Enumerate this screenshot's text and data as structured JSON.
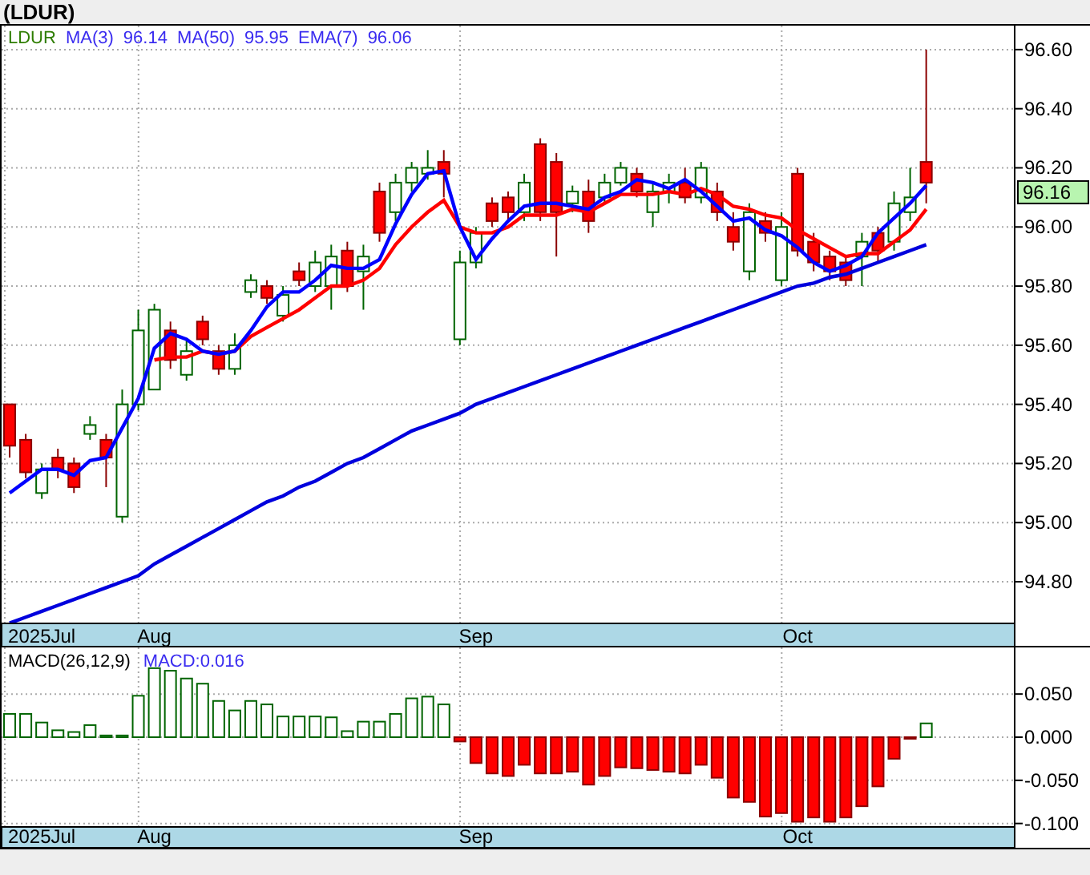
{
  "title": "(LDUR)",
  "price_chart": {
    "symbol": "LDUR",
    "indicators": [
      {
        "label": "MA(3)",
        "value": "96.14"
      },
      {
        "label": "MA(50)",
        "value": "95.95"
      },
      {
        "label": "EMA(7)",
        "value": "96.06"
      }
    ],
    "last_price": "96.16",
    "chart_data": {
      "type": "candlestick",
      "grid": true,
      "categories": [
        null,
        null,
        "2025Jul",
        null,
        null,
        null,
        null,
        null,
        null,
        "Aug",
        null,
        null,
        null,
        null,
        null,
        null,
        null,
        null,
        null,
        null,
        null,
        null,
        null,
        null,
        null,
        null,
        null,
        null,
        null,
        "Sep",
        null,
        null,
        null,
        null,
        null,
        null,
        null,
        null,
        null,
        null,
        null,
        null,
        null,
        null,
        null,
        null,
        null,
        null,
        null,
        "Oct",
        null,
        null,
        null,
        null,
        null,
        null,
        null,
        null,
        null,
        null,
        null,
        null,
        null
      ],
      "ylim": [
        94.659,
        96.681
      ],
      "yticks": [
        {
          "value": 96.6,
          "label": "96.60"
        },
        {
          "value": 96.4,
          "label": "96.40"
        },
        {
          "value": 96.2,
          "label": "96.20"
        },
        {
          "value": 96.0,
          "label": "96.00"
        },
        {
          "value": 95.8,
          "label": "95.80"
        },
        {
          "value": 95.6,
          "label": "95.60"
        },
        {
          "value": 95.4,
          "label": "95.40"
        },
        {
          "value": 95.2,
          "label": "95.20"
        },
        {
          "value": 95.0,
          "label": "95.00"
        },
        {
          "value": 94.8,
          "label": "94.80"
        }
      ],
      "ohlc": [
        [
          95.4,
          95.4,
          95.22,
          95.26
        ],
        [
          95.28,
          95.3,
          95.15,
          95.17
        ],
        [
          95.1,
          95.2,
          95.08,
          95.18
        ],
        [
          95.22,
          95.25,
          95.15,
          95.18
        ],
        [
          95.2,
          95.22,
          95.1,
          95.12
        ],
        [
          95.3,
          95.36,
          95.28,
          95.33
        ],
        [
          95.28,
          95.3,
          95.12,
          95.22
        ],
        [
          95.02,
          95.45,
          95.0,
          95.4
        ],
        [
          95.4,
          95.72,
          95.38,
          95.65
        ],
        [
          95.45,
          95.74,
          95.45,
          95.72
        ],
        [
          95.65,
          95.68,
          95.52,
          95.55
        ],
        [
          95.5,
          95.62,
          95.48,
          95.58
        ],
        [
          95.68,
          95.7,
          95.6,
          95.62
        ],
        [
          95.58,
          95.6,
          95.5,
          95.52
        ],
        [
          95.52,
          95.64,
          95.5,
          95.6
        ],
        [
          95.78,
          95.84,
          95.76,
          95.82
        ],
        [
          95.8,
          95.82,
          95.74,
          95.76
        ],
        [
          95.7,
          95.8,
          95.68,
          95.77
        ],
        [
          95.85,
          95.88,
          95.8,
          95.82
        ],
        [
          95.8,
          95.92,
          95.78,
          95.88
        ],
        [
          95.8,
          95.94,
          95.72,
          95.9
        ],
        [
          95.92,
          95.95,
          95.78,
          95.8
        ],
        [
          95.85,
          95.94,
          95.72,
          95.9
        ],
        [
          96.12,
          96.15,
          95.95,
          95.98
        ],
        [
          96.05,
          96.18,
          96.02,
          96.15
        ],
        [
          96.15,
          96.22,
          96.12,
          96.2
        ],
        [
          96.18,
          96.26,
          96.16,
          96.2
        ],
        [
          96.22,
          96.26,
          96.1,
          96.18
        ],
        [
          95.62,
          95.92,
          95.6,
          95.88
        ],
        [
          95.88,
          96.0,
          95.86,
          95.98
        ],
        [
          96.08,
          96.1,
          96.0,
          96.02
        ],
        [
          96.1,
          96.12,
          96.02,
          96.05
        ],
        [
          96.05,
          96.18,
          96.02,
          96.15
        ],
        [
          96.28,
          96.3,
          96.02,
          96.05
        ],
        [
          96.22,
          96.25,
          95.9,
          96.05
        ],
        [
          96.08,
          96.14,
          96.05,
          96.12
        ],
        [
          96.12,
          96.16,
          95.98,
          96.02
        ],
        [
          96.1,
          96.18,
          96.08,
          96.15
        ],
        [
          96.15,
          96.22,
          96.14,
          96.2
        ],
        [
          96.18,
          96.2,
          96.1,
          96.12
        ],
        [
          96.05,
          96.15,
          96.0,
          96.12
        ],
        [
          96.12,
          96.18,
          96.08,
          96.15
        ],
        [
          96.15,
          96.2,
          96.08,
          96.1
        ],
        [
          96.1,
          96.22,
          96.08,
          96.2
        ],
        [
          96.12,
          96.15,
          96.02,
          96.05
        ],
        [
          96.0,
          96.05,
          95.92,
          95.95
        ],
        [
          95.85,
          96.08,
          95.82,
          96.05
        ],
        [
          96.02,
          96.05,
          95.95,
          95.98
        ],
        [
          95.82,
          96.05,
          95.8,
          96.0
        ],
        [
          96.18,
          96.2,
          95.9,
          95.92
        ],
        [
          95.95,
          95.98,
          95.85,
          95.88
        ],
        [
          95.9,
          95.92,
          95.82,
          95.85
        ],
        [
          95.88,
          95.9,
          95.8,
          95.82
        ],
        [
          95.9,
          95.98,
          95.8,
          95.95
        ],
        [
          95.98,
          96.0,
          95.88,
          95.92
        ],
        [
          95.95,
          96.12,
          95.92,
          96.08
        ],
        [
          96.05,
          96.2,
          96.02,
          96.1
        ],
        [
          96.22,
          96.6,
          96.08,
          96.15
        ],
        null,
        null,
        null,
        null,
        null
      ],
      "series": [
        {
          "type": "line",
          "color": "#0000dd",
          "values": [
            94.66,
            94.68,
            94.7,
            94.72,
            94.74,
            94.76,
            94.78,
            94.8,
            94.82,
            94.86,
            94.89,
            94.92,
            94.95,
            94.98,
            95.01,
            95.04,
            95.07,
            95.09,
            95.12,
            95.14,
            95.17,
            95.2,
            95.22,
            95.25,
            95.28,
            95.31,
            95.33,
            95.35,
            95.37,
            95.4,
            95.42,
            95.44,
            95.46,
            95.48,
            95.5,
            95.52,
            95.54,
            95.56,
            95.58,
            95.6,
            95.62,
            95.64,
            95.66,
            95.68,
            95.7,
            95.72,
            95.74,
            95.76,
            95.78,
            95.8,
            95.81,
            95.83,
            95.84,
            95.86,
            95.88,
            95.9,
            95.92,
            95.94,
            null,
            null,
            null,
            null,
            null
          ]
        },
        {
          "type": "line",
          "color": "#ff0000",
          "values": [
            null,
            null,
            null,
            null,
            null,
            null,
            null,
            null,
            null,
            95.55,
            95.56,
            95.56,
            95.58,
            95.57,
            95.58,
            95.63,
            95.66,
            95.69,
            95.72,
            95.76,
            95.8,
            95.8,
            95.82,
            95.86,
            95.94,
            96.0,
            96.05,
            96.09,
            96.0,
            95.98,
            95.98,
            96.0,
            96.04,
            96.04,
            96.04,
            96.06,
            96.05,
            96.08,
            96.11,
            96.11,
            96.11,
            96.12,
            96.11,
            96.13,
            96.11,
            96.07,
            96.06,
            96.04,
            96.03,
            95.99,
            95.96,
            95.93,
            95.9,
            95.91,
            95.91,
            95.95,
            95.99,
            96.06,
            null,
            null,
            null,
            null,
            null
          ]
        },
        {
          "type": "line",
          "color": "#0000ff",
          "values": [
            95.1,
            95.14,
            95.18,
            95.18,
            95.16,
            95.21,
            95.22,
            95.32,
            95.42,
            95.59,
            95.64,
            95.62,
            95.58,
            95.57,
            95.58,
            95.65,
            95.73,
            95.78,
            95.78,
            95.82,
            95.87,
            95.86,
            95.86,
            95.89,
            96.01,
            96.11,
            96.18,
            96.19,
            96.0,
            95.89,
            95.96,
            96.02,
            96.07,
            96.08,
            96.08,
            96.07,
            96.06,
            96.1,
            96.12,
            96.16,
            96.15,
            96.13,
            96.16,
            96.12,
            96.07,
            96.02,
            96.03,
            95.99,
            95.97,
            95.93,
            95.88,
            95.85,
            95.87,
            95.9,
            95.98,
            96.03,
            96.08,
            96.14,
            null,
            null,
            null,
            null,
            null
          ]
        }
      ]
    }
  },
  "macd_chart": {
    "label": "MACD(26,12,9)",
    "reading": "MACD:0.016",
    "chart_data": {
      "type": "bar",
      "grid": true,
      "categories": [
        null,
        null,
        "2025Jul",
        null,
        null,
        null,
        null,
        null,
        null,
        "Aug",
        null,
        null,
        null,
        null,
        null,
        null,
        null,
        null,
        null,
        null,
        null,
        null,
        null,
        null,
        null,
        null,
        null,
        null,
        null,
        "Sep",
        null,
        null,
        null,
        null,
        null,
        null,
        null,
        null,
        null,
        null,
        null,
        null,
        null,
        null,
        null,
        null,
        null,
        null,
        null,
        "Oct",
        null,
        null,
        null,
        null,
        null,
        null,
        null,
        null,
        null,
        null,
        null,
        null,
        null
      ],
      "ylim": [
        -0.104,
        0.104
      ],
      "yticks": [
        {
          "value": 0.05,
          "label": "0.050"
        },
        {
          "value": 0,
          "label": "0.000"
        },
        {
          "value": -0.05,
          "label": "-0.050"
        },
        {
          "value": -0.1,
          "label": "-0.100"
        }
      ],
      "values": [
        0.027,
        0.027,
        0.017,
        0.008,
        0.006,
        0.014,
        0.002,
        0.002,
        0.048,
        0.08,
        0.077,
        0.068,
        0.062,
        0.042,
        0.031,
        0.042,
        0.038,
        0.024,
        0.024,
        0.024,
        0.023,
        0.007,
        0.018,
        0.018,
        0.027,
        0.045,
        0.047,
        0.038,
        -0.005,
        -0.03,
        -0.042,
        -0.045,
        -0.032,
        -0.042,
        -0.042,
        -0.04,
        -0.055,
        -0.045,
        -0.035,
        -0.036,
        -0.038,
        -0.04,
        -0.042,
        -0.032,
        -0.047,
        -0.07,
        -0.075,
        -0.092,
        -0.088,
        -0.098,
        -0.093,
        -0.098,
        -0.093,
        -0.08,
        -0.057,
        -0.025,
        -0.001,
        0.016,
        null,
        null,
        null,
        null,
        null
      ]
    }
  }
}
